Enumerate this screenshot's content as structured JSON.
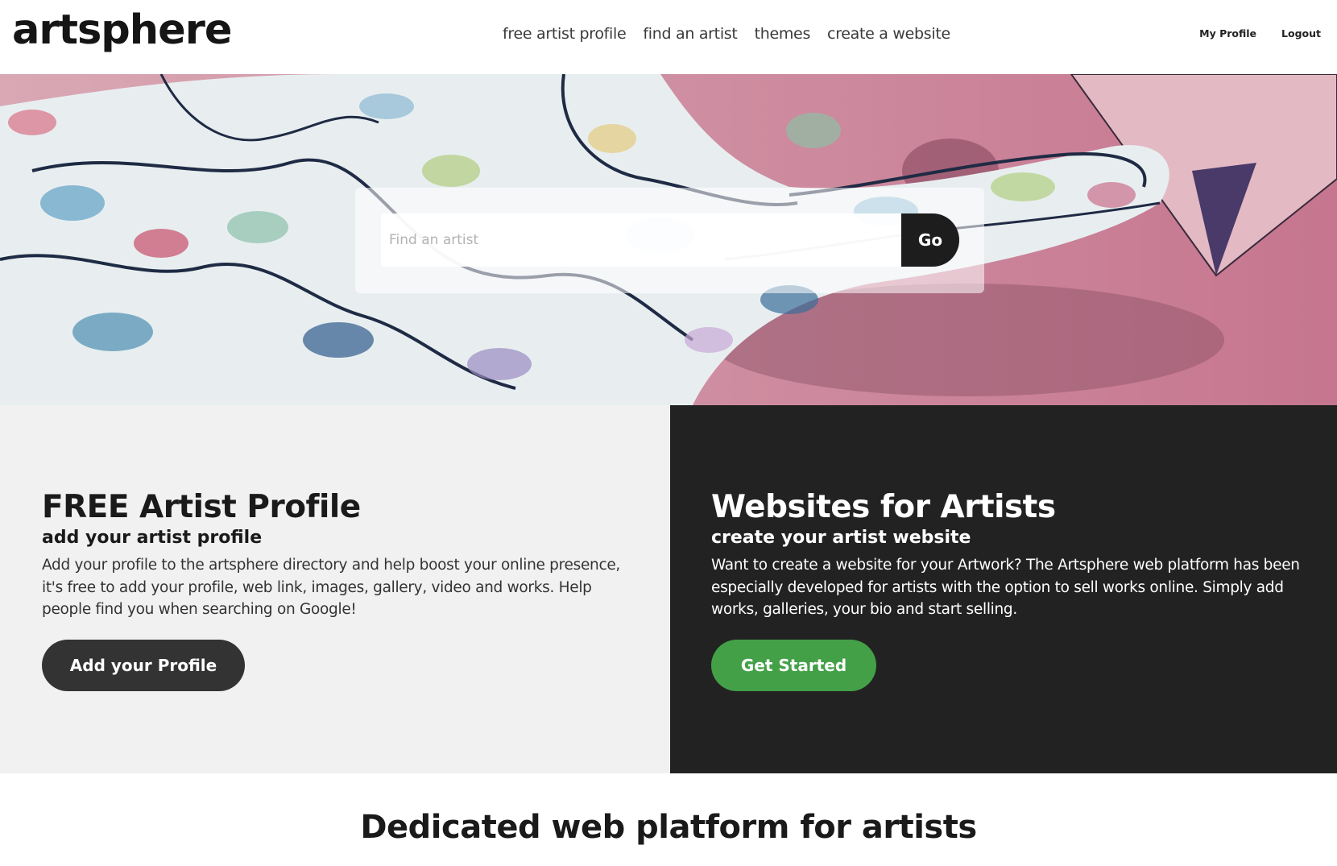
{
  "header": {
    "logo": "artsphere",
    "nav": [
      "free artist profile",
      "find an artist",
      "themes",
      "create a website"
    ],
    "user_nav": {
      "profile": "My Profile",
      "logout": "Logout"
    }
  },
  "search": {
    "placeholder": "Find an artist",
    "value": "",
    "button": "Go"
  },
  "features": {
    "left": {
      "title": "FREE Artist Profile",
      "subtitle": "add your artist profile",
      "body": "Add your profile to the artsphere directory and help boost your online presence, it's free to add your profile, web link, images, gallery, video and works. Help people find you when searching on Google!",
      "button": "Add your Profile"
    },
    "right": {
      "title": "Websites for Artists",
      "subtitle": "create your artist website",
      "body": "Want to create a website for your Artwork? The Artsphere web platform has been especially developed for artists with the option to sell works online. Simply add works, galleries, your bio and start selling.",
      "button": "Get Started"
    }
  },
  "bottom": {
    "title": "Dedicated web platform for artists"
  },
  "colors": {
    "dark": "#222222",
    "green": "#43a047",
    "light_panel": "#f1f1f1",
    "hero_pink": "#c9788f"
  }
}
